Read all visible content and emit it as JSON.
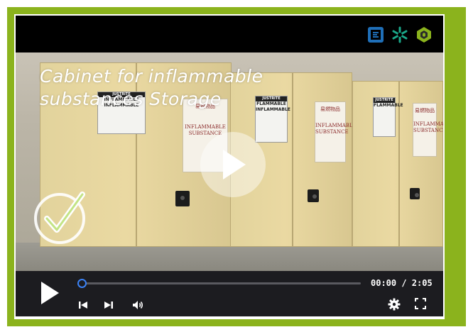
{
  "colors": {
    "frame_green": "#8bb31d",
    "player_bg": "#000000",
    "controls_bg": "#1c1c20",
    "progress_accent": "#3b82f6",
    "check_green": "#9bd235",
    "logo_blue": "#1f6fb8",
    "logo_teal": "#1aa98a",
    "logo_green": "#8bb31d"
  },
  "header": {
    "logos": [
      "square-e-logo-icon",
      "snowflake-logo-icon",
      "hexagon-b-logo-icon"
    ]
  },
  "video": {
    "caption_line1": "Cabinet for inflammable",
    "caption_line2": "substances Storage",
    "cabinet_labels": {
      "sticker_brand": "JUSTRITE",
      "sticker_text1": "FLAMMABLE",
      "sticker_text2": "INFLAMMABLE",
      "big_text1": "INFLAMMABLE",
      "big_text2": "INFLAMMABLE",
      "card_cn": "易燃物品",
      "card_text": "INFLAMMABLE SUBSTANCE"
    },
    "overlay_icon": "check-circle-icon",
    "play_icon": "play-icon"
  },
  "controls": {
    "time_display": "00:00 / 2:05",
    "progress": 0.0,
    "icons": [
      "play-icon",
      "skip-previous-icon",
      "skip-next-icon",
      "volume-icon",
      "settings-gear-icon",
      "fullscreen-icon"
    ]
  }
}
